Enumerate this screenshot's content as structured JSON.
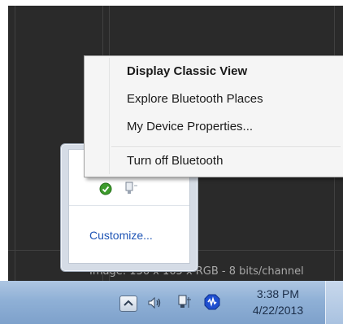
{
  "background_app": {
    "status_text": "Image: 136 x 165 x RGB - 8 bits/channel"
  },
  "context_menu": {
    "items": [
      {
        "label": "Display Classic View",
        "bold": true
      },
      {
        "label": "Explore Bluetooth Places",
        "bold": false
      },
      {
        "label": "My Device Properties...",
        "bold": false
      },
      {
        "label": "Turn off Bluetooth",
        "bold": false
      }
    ]
  },
  "overflow_panel": {
    "icons": [
      "green-shield-icon",
      "network-icon"
    ],
    "customize_label": "Customize..."
  },
  "taskbar": {
    "tray_icons": [
      "show-hidden-icons-arrow",
      "speaker-icon",
      "network-icon",
      "bluetooth-icon"
    ],
    "clock": {
      "time": "3:38 PM",
      "date": "4/22/2013"
    }
  },
  "colors": {
    "link": "#1f55b5",
    "taskbar": "#8fb0d6",
    "menu_bg": "#f5f5f5",
    "bluetooth_blue": "#1f4fd0"
  }
}
